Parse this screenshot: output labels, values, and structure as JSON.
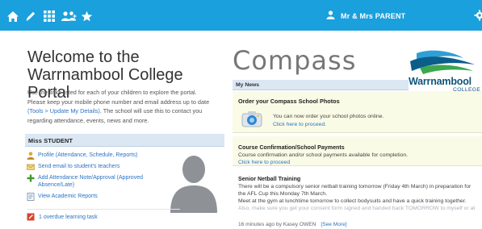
{
  "topbar": {
    "user_name": "Mr & Mrs PARENT",
    "icons": [
      "home-icon",
      "edit-icon",
      "apps-grid-icon",
      "people-icon",
      "star-icon"
    ],
    "color": "#1aa0dd"
  },
  "welcome": {
    "title": "Welcome to the Warrnambool College Portal",
    "intro_part1": "Use the links listed for each of your children to explore the portal. Please keep your mobile phone number and email address up to date ",
    "intro_link": "(Tools > Update My Details)",
    "intro_part2": ". The school will use this to contact you regarding attendance, events, news and more."
  },
  "student": {
    "header": "Miss STUDENT",
    "links": [
      "Profile (Attendance, Schedule, Reports)",
      "Send email to student's teachers",
      "Add Attendance Note/Approval (Approved Absence/Late)",
      "View Academic Reports"
    ],
    "overdue": "1 overdue learning task"
  },
  "compass": {
    "title": "Compass",
    "logo_name": "Warrnambool",
    "logo_sub": "COLLEGE",
    "news_header": "My News"
  },
  "news": [
    {
      "title": "Order your Compass School Photos",
      "line1": "You can now order your school photos online.",
      "link": "Click here to proceed."
    },
    {
      "title": "Course Confirmation/School Payments",
      "line1": "Course confirmation and/or school payments available for completion.",
      "link": "Click here to proceed"
    },
    {
      "title": "Senior Netball Training",
      "line1": "There will be a compulsory senior netball training tomorrow (Friday 4th March) in preparation for",
      "line2": "the AFL Cup this Monday 7th March.",
      "line3": "Meet at the gym at lunchtime tomorrow to collect bodysuits and have a quick training together.",
      "line4": "Also, make sure you get your consent form signed and handed back TOMORROW to myself or at",
      "meta": "16 minutes ago by Kasey OWEN",
      "see_more": "[See More]"
    }
  ]
}
